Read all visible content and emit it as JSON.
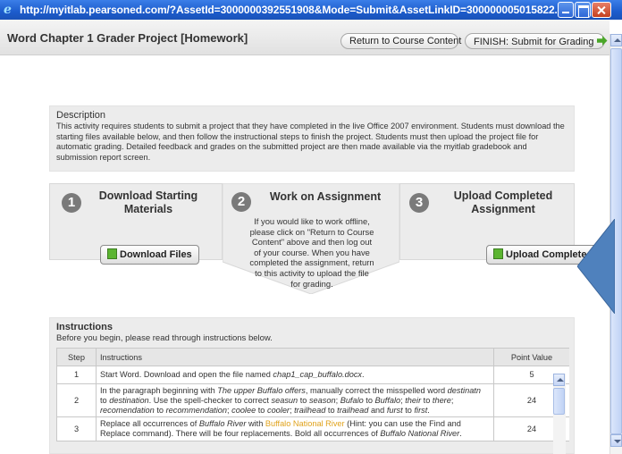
{
  "window": {
    "title": "http://myitlab.pearsoned.com/?AssetId=3000000392551908&Mode=Submit&AssetLinkID=300000005015822..."
  },
  "header": {
    "page_title": "Word Chapter 1 Grader Project [Homework]",
    "return_label": "Return to Course Content",
    "finish_label": "FINISH: Submit for Grading"
  },
  "description": {
    "heading": "Description",
    "body": "This activity requires students to submit a project that they have completed in the live Office 2007 environment. Students must download the starting files available below, and then follow the instructional steps to finish the project. Students must then upload the project file for automatic grading. Detailed feedback and grades on the submitted project are then made available via the myitlab gradebook and submission report screen."
  },
  "steps": [
    {
      "number": "1",
      "title": "Download Starting Materials",
      "button": "Download Files"
    },
    {
      "number": "2",
      "title": "Work on Assignment",
      "text": "If you would like to work offline, please click on \"Return to Course Content\" above and then log out of your course. When you have completed the assignment, return to this activity to upload the file for grading."
    },
    {
      "number": "3",
      "title": "Upload Completed Assignment",
      "button": "Upload Completed File"
    }
  ],
  "instructions": {
    "heading": "Instructions",
    "subtitle": "Before you begin, please read through instructions below.",
    "columns": [
      "Step",
      "Instructions",
      "Point Value"
    ],
    "rows": [
      {
        "step": "1",
        "points": "5"
      },
      {
        "step": "2",
        "points": "24"
      },
      {
        "step": "3",
        "points": "24"
      }
    ]
  },
  "colors": {
    "titlebar": "#1c5ccc",
    "highlight": "#e0a21b",
    "callout": "#4f81bd"
  }
}
